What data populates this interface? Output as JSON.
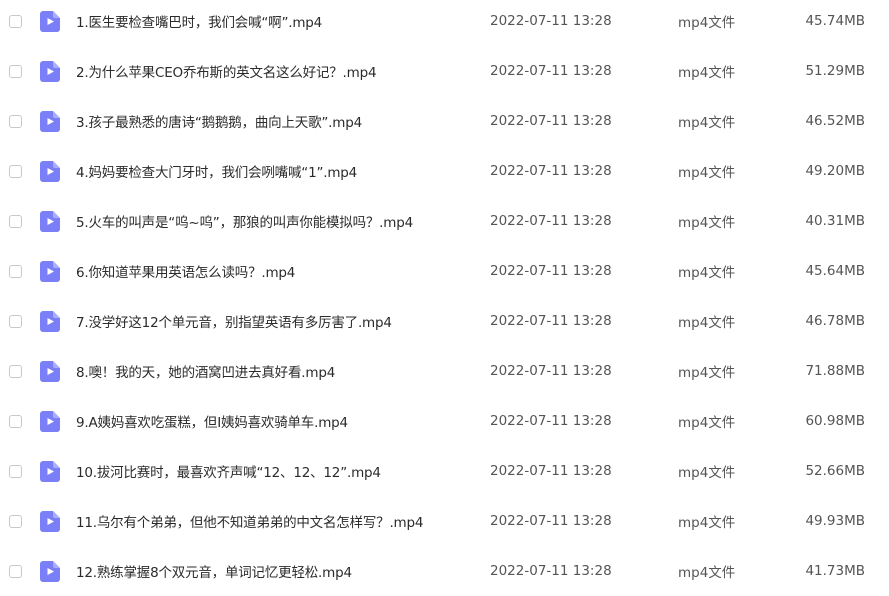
{
  "files": [
    {
      "name": "1.医生要检查嘴巴时，我们会喊“啊”.mp4",
      "date": "2022-07-11 13:28",
      "type": "mp4文件",
      "size": "45.74MB"
    },
    {
      "name": "2.为什么苹果CEO乔布斯的英文名这么好记？.mp4",
      "date": "2022-07-11 13:28",
      "type": "mp4文件",
      "size": "51.29MB"
    },
    {
      "name": "3.孩子最熟悉的唐诗“鹅鹅鹅，曲向上天歌”.mp4",
      "date": "2022-07-11 13:28",
      "type": "mp4文件",
      "size": "46.52MB"
    },
    {
      "name": "4.妈妈要检查大门牙时，我们会咧嘴喊“1”.mp4",
      "date": "2022-07-11 13:28",
      "type": "mp4文件",
      "size": "49.20MB"
    },
    {
      "name": "5.火车的叫声是“呜~呜”，那狼的叫声你能模拟吗？.mp4",
      "date": "2022-07-11 13:28",
      "type": "mp4文件",
      "size": "40.31MB"
    },
    {
      "name": "6.你知道苹果用英语怎么读吗？.mp4",
      "date": "2022-07-11 13:28",
      "type": "mp4文件",
      "size": "45.64MB"
    },
    {
      "name": "7.没学好这12个单元音，别指望英语有多厉害了.mp4",
      "date": "2022-07-11 13:28",
      "type": "mp4文件",
      "size": "46.78MB"
    },
    {
      "name": "8.噢！我的天，她的酒窝凹进去真好看.mp4",
      "date": "2022-07-11 13:28",
      "type": "mp4文件",
      "size": "71.88MB"
    },
    {
      "name": "9.A姨妈喜欢吃蛋糕，但I姨妈喜欢骑单车.mp4",
      "date": "2022-07-11 13:28",
      "type": "mp4文件",
      "size": "60.98MB"
    },
    {
      "name": "10.拔河比赛时，最喜欢齐声喊“12、12、12”.mp4",
      "date": "2022-07-11 13:28",
      "type": "mp4文件",
      "size": "52.66MB"
    },
    {
      "name": "11.乌尔有个弟弟，但他不知道弟弟的中文名怎样写？.mp4",
      "date": "2022-07-11 13:28",
      "type": "mp4文件",
      "size": "49.93MB"
    },
    {
      "name": "12.熟练掌握8个双元音，单词记忆更轻松.mp4",
      "date": "2022-07-11 13:28",
      "type": "mp4文件",
      "size": "41.73MB"
    }
  ],
  "icons": {
    "row_checkbox": "checkbox-icon",
    "file_type": "video-file-icon"
  },
  "colors": {
    "video_icon": "#7b7ff7",
    "checkbox_border": "#c8c8c8",
    "name_text": "#2b2b2b",
    "meta_text": "#555555"
  }
}
